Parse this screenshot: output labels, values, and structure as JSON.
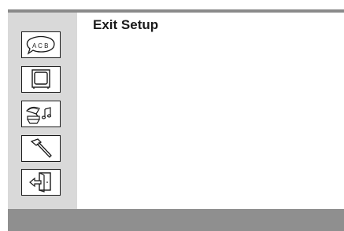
{
  "header": {
    "title": "Exit Setup"
  },
  "sidebar": {
    "items": [
      {
        "icon": "language-abc-icon",
        "label": "A C B"
      },
      {
        "icon": "picture-tv-icon"
      },
      {
        "icon": "sound-gramophone-icon"
      },
      {
        "icon": "setup-hammer-icon"
      },
      {
        "icon": "exit-door-icon"
      }
    ]
  },
  "colors": {
    "sidebar_bg": "#d9d9d9",
    "bottom_bar": "#8f8f8f",
    "top_border": "#8a8a8a",
    "icon_stroke": "#1a1a1a"
  }
}
